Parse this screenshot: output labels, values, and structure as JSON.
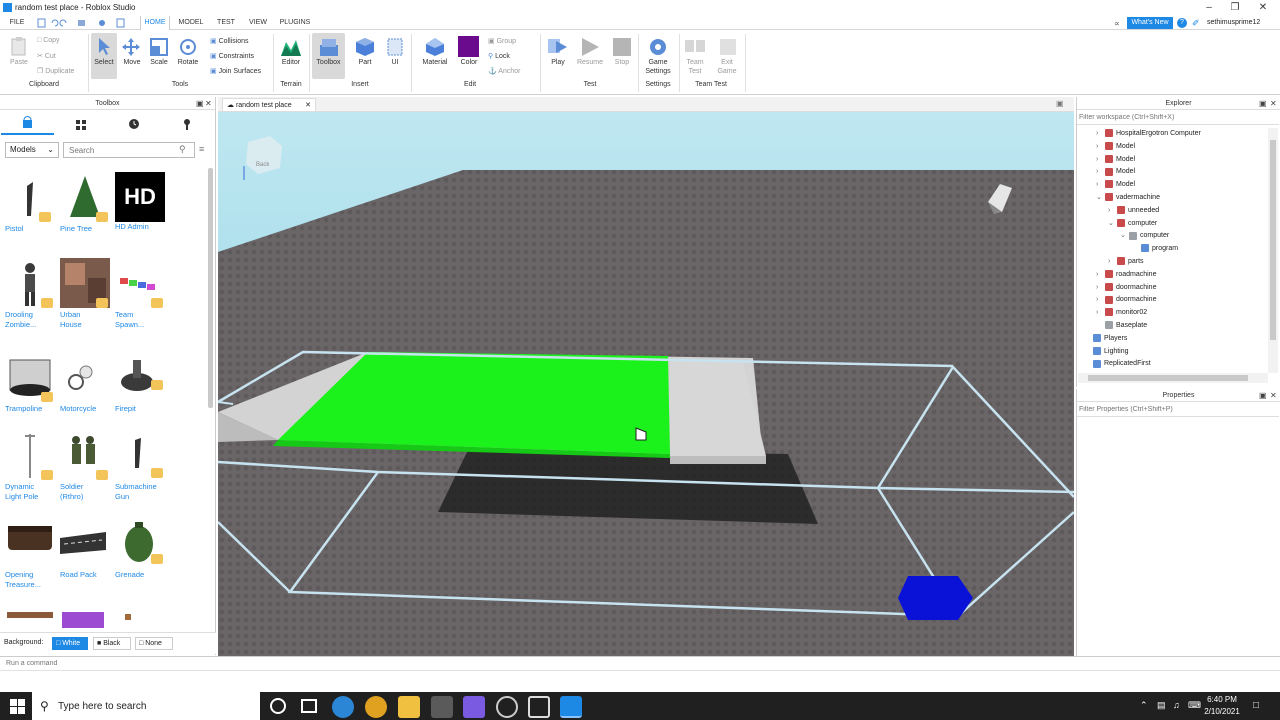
{
  "window": {
    "title": "random test place - Roblox Studio"
  },
  "menu": {
    "items": [
      "FILE",
      "HOME",
      "MODEL",
      "TEST",
      "VIEW",
      "PLUGINS"
    ],
    "active": "HOME"
  },
  "topright": {
    "whats_new": "What's New",
    "user": "sethimusprime12"
  },
  "ribbon": {
    "clipboard": {
      "paste": "Paste",
      "copy": "Copy",
      "cut": "Cut",
      "duplicate": "Duplicate",
      "group": "Clipboard"
    },
    "tools": {
      "select": "Select",
      "move": "Move",
      "scale": "Scale",
      "rotate": "Rotate",
      "collisions": "Collisions",
      "constraints": "Constraints",
      "join": "Join Surfaces",
      "group": "Tools"
    },
    "terrain": {
      "editor": "Editor",
      "group": "Terrain"
    },
    "insert": {
      "toolbox": "Toolbox",
      "part": "Part",
      "ui": "UI",
      "group": "Insert"
    },
    "edit": {
      "material": "Material",
      "color": "Color",
      "group_btn": "Group",
      "lock": "Lock",
      "anchor": "Anchor",
      "group": "Edit"
    },
    "test": {
      "play": "Play",
      "resume": "Resume",
      "stop": "Stop",
      "group": "Test"
    },
    "settings": {
      "game_settings_1": "Game",
      "game_settings_2": "Settings",
      "group": "Settings"
    },
    "teamtest": {
      "team_1": "Team",
      "team_2": "Test",
      "exit_1": "Exit",
      "exit_2": "Game",
      "group": "Team Test"
    }
  },
  "toolbox": {
    "title": "Toolbox",
    "category": "Models",
    "search_placeholder": "Search",
    "items": [
      {
        "l1": "Pistol",
        "l2": ""
      },
      {
        "l1": "Pine Tree",
        "l2": ""
      },
      {
        "l1": "HD Admin",
        "l2": ""
      },
      {
        "l1": "Drooling",
        "l2": "Zombie..."
      },
      {
        "l1": "Urban",
        "l2": "House"
      },
      {
        "l1": "Team",
        "l2": "Spawn..."
      },
      {
        "l1": "Trampoline",
        "l2": ""
      },
      {
        "l1": "Motorcycle",
        "l2": ""
      },
      {
        "l1": "Firepit",
        "l2": ""
      },
      {
        "l1": "Dynamic",
        "l2": "Light Pole"
      },
      {
        "l1": "Soldier",
        "l2": "(Rthro)"
      },
      {
        "l1": "Submachine",
        "l2": "Gun"
      },
      {
        "l1": "Opening",
        "l2": "Treasure..."
      },
      {
        "l1": "Road Pack",
        "l2": ""
      },
      {
        "l1": "Grenade",
        "l2": ""
      }
    ],
    "hd_text": "HD",
    "background_label": "Background:",
    "bg_options": [
      "White",
      "Black",
      "None"
    ]
  },
  "viewport": {
    "tab": "random test place",
    "cube_label": "Back"
  },
  "explorer": {
    "title": "Explorer",
    "filter_placeholder": "Filter workspace (Ctrl+Shift+X)",
    "rows": [
      {
        "label": "HospitalErgotron Computer",
        "indent": 1,
        "arrow": ">"
      },
      {
        "label": "Model",
        "indent": 1,
        "arrow": ">"
      },
      {
        "label": "Model",
        "indent": 1,
        "arrow": ">"
      },
      {
        "label": "Model",
        "indent": 1,
        "arrow": ">"
      },
      {
        "label": "Model",
        "indent": 1,
        "arrow": ">"
      },
      {
        "label": "vadermachine",
        "indent": 1,
        "arrow": "v"
      },
      {
        "label": "unneeded",
        "indent": 2,
        "arrow": ">"
      },
      {
        "label": "computer",
        "indent": 2,
        "arrow": "v"
      },
      {
        "label": "computer",
        "indent": 3,
        "arrow": "v"
      },
      {
        "label": "program",
        "indent": 4,
        "arrow": ""
      },
      {
        "label": "parts",
        "indent": 2,
        "arrow": ">"
      },
      {
        "label": "roadmachine",
        "indent": 1,
        "arrow": ">"
      },
      {
        "label": "doormachine",
        "indent": 1,
        "arrow": ">"
      },
      {
        "label": "doormachine",
        "indent": 1,
        "arrow": ">"
      },
      {
        "label": "monitor02",
        "indent": 1,
        "arrow": ">"
      },
      {
        "label": "Baseplate",
        "indent": 1,
        "arrow": ""
      },
      {
        "label": "Players",
        "indent": 0,
        "arrow": ""
      },
      {
        "label": "Lighting",
        "indent": 0,
        "arrow": ""
      },
      {
        "label": "ReplicatedFirst",
        "indent": 0,
        "arrow": ""
      }
    ]
  },
  "properties": {
    "title": "Properties",
    "filter_placeholder": "Filter Properties (Ctrl+Shift+P)"
  },
  "command": {
    "placeholder": "Run a command"
  },
  "taskbar": {
    "search": "Type here to search",
    "time": "6:40 PM",
    "date": "2/10/2021"
  }
}
